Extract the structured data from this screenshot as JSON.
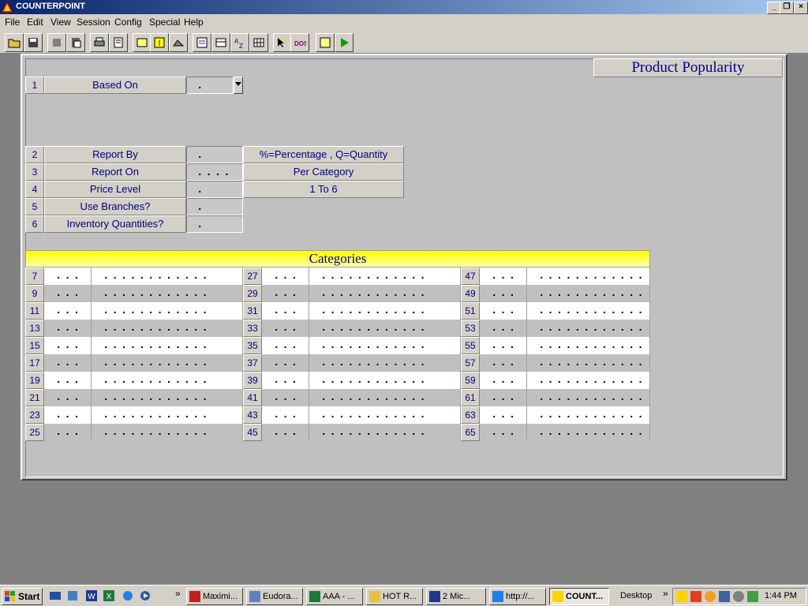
{
  "window": {
    "title": "COUNTERPOINT"
  },
  "menu": [
    "File",
    "Edit",
    "View",
    "Session",
    "Config",
    "Special",
    "Help"
  ],
  "report_title": "Product Popularity",
  "fields": [
    {
      "num": "1",
      "label": "Based On",
      "value": "."
    },
    {
      "num": "2",
      "label": "Report By",
      "value": ".",
      "hint": "%=Percentage , Q=Quantity"
    },
    {
      "num": "3",
      "label": "Report On",
      "value": "....",
      "hint": "Per Category"
    },
    {
      "num": "4",
      "label": "Price Level",
      "value": ".",
      "hint": "1 To 6"
    },
    {
      "num": "5",
      "label": "Use Branches?",
      "value": "."
    },
    {
      "num": "6",
      "label": "Inventory Quantities?",
      "value": "."
    }
  ],
  "categories_title": "Categories",
  "category_rows": [
    {
      "nums": [
        "7",
        "27",
        "47"
      ]
    },
    {
      "nums": [
        "9",
        "29",
        "49"
      ]
    },
    {
      "nums": [
        "11",
        "31",
        "51"
      ]
    },
    {
      "nums": [
        "13",
        "33",
        "53"
      ]
    },
    {
      "nums": [
        "15",
        "35",
        "55"
      ]
    },
    {
      "nums": [
        "17",
        "37",
        "57"
      ]
    },
    {
      "nums": [
        "19",
        "39",
        "59"
      ]
    },
    {
      "nums": [
        "21",
        "41",
        "61"
      ]
    },
    {
      "nums": [
        "23",
        "43",
        "63"
      ]
    },
    {
      "nums": [
        "25",
        "45",
        "65"
      ]
    }
  ],
  "category_code_value": "...",
  "category_desc_value": "............",
  "taskbar": {
    "start": "Start",
    "chevron": "»",
    "tasks": [
      "Maximi...",
      "Eudora...",
      "AAA - ...",
      "HOT R...",
      "2 Mic...",
      "http://...",
      "COUNT..."
    ],
    "desktop": "Desktop",
    "tray_chevron": "»",
    "clock": "1:44 PM"
  }
}
